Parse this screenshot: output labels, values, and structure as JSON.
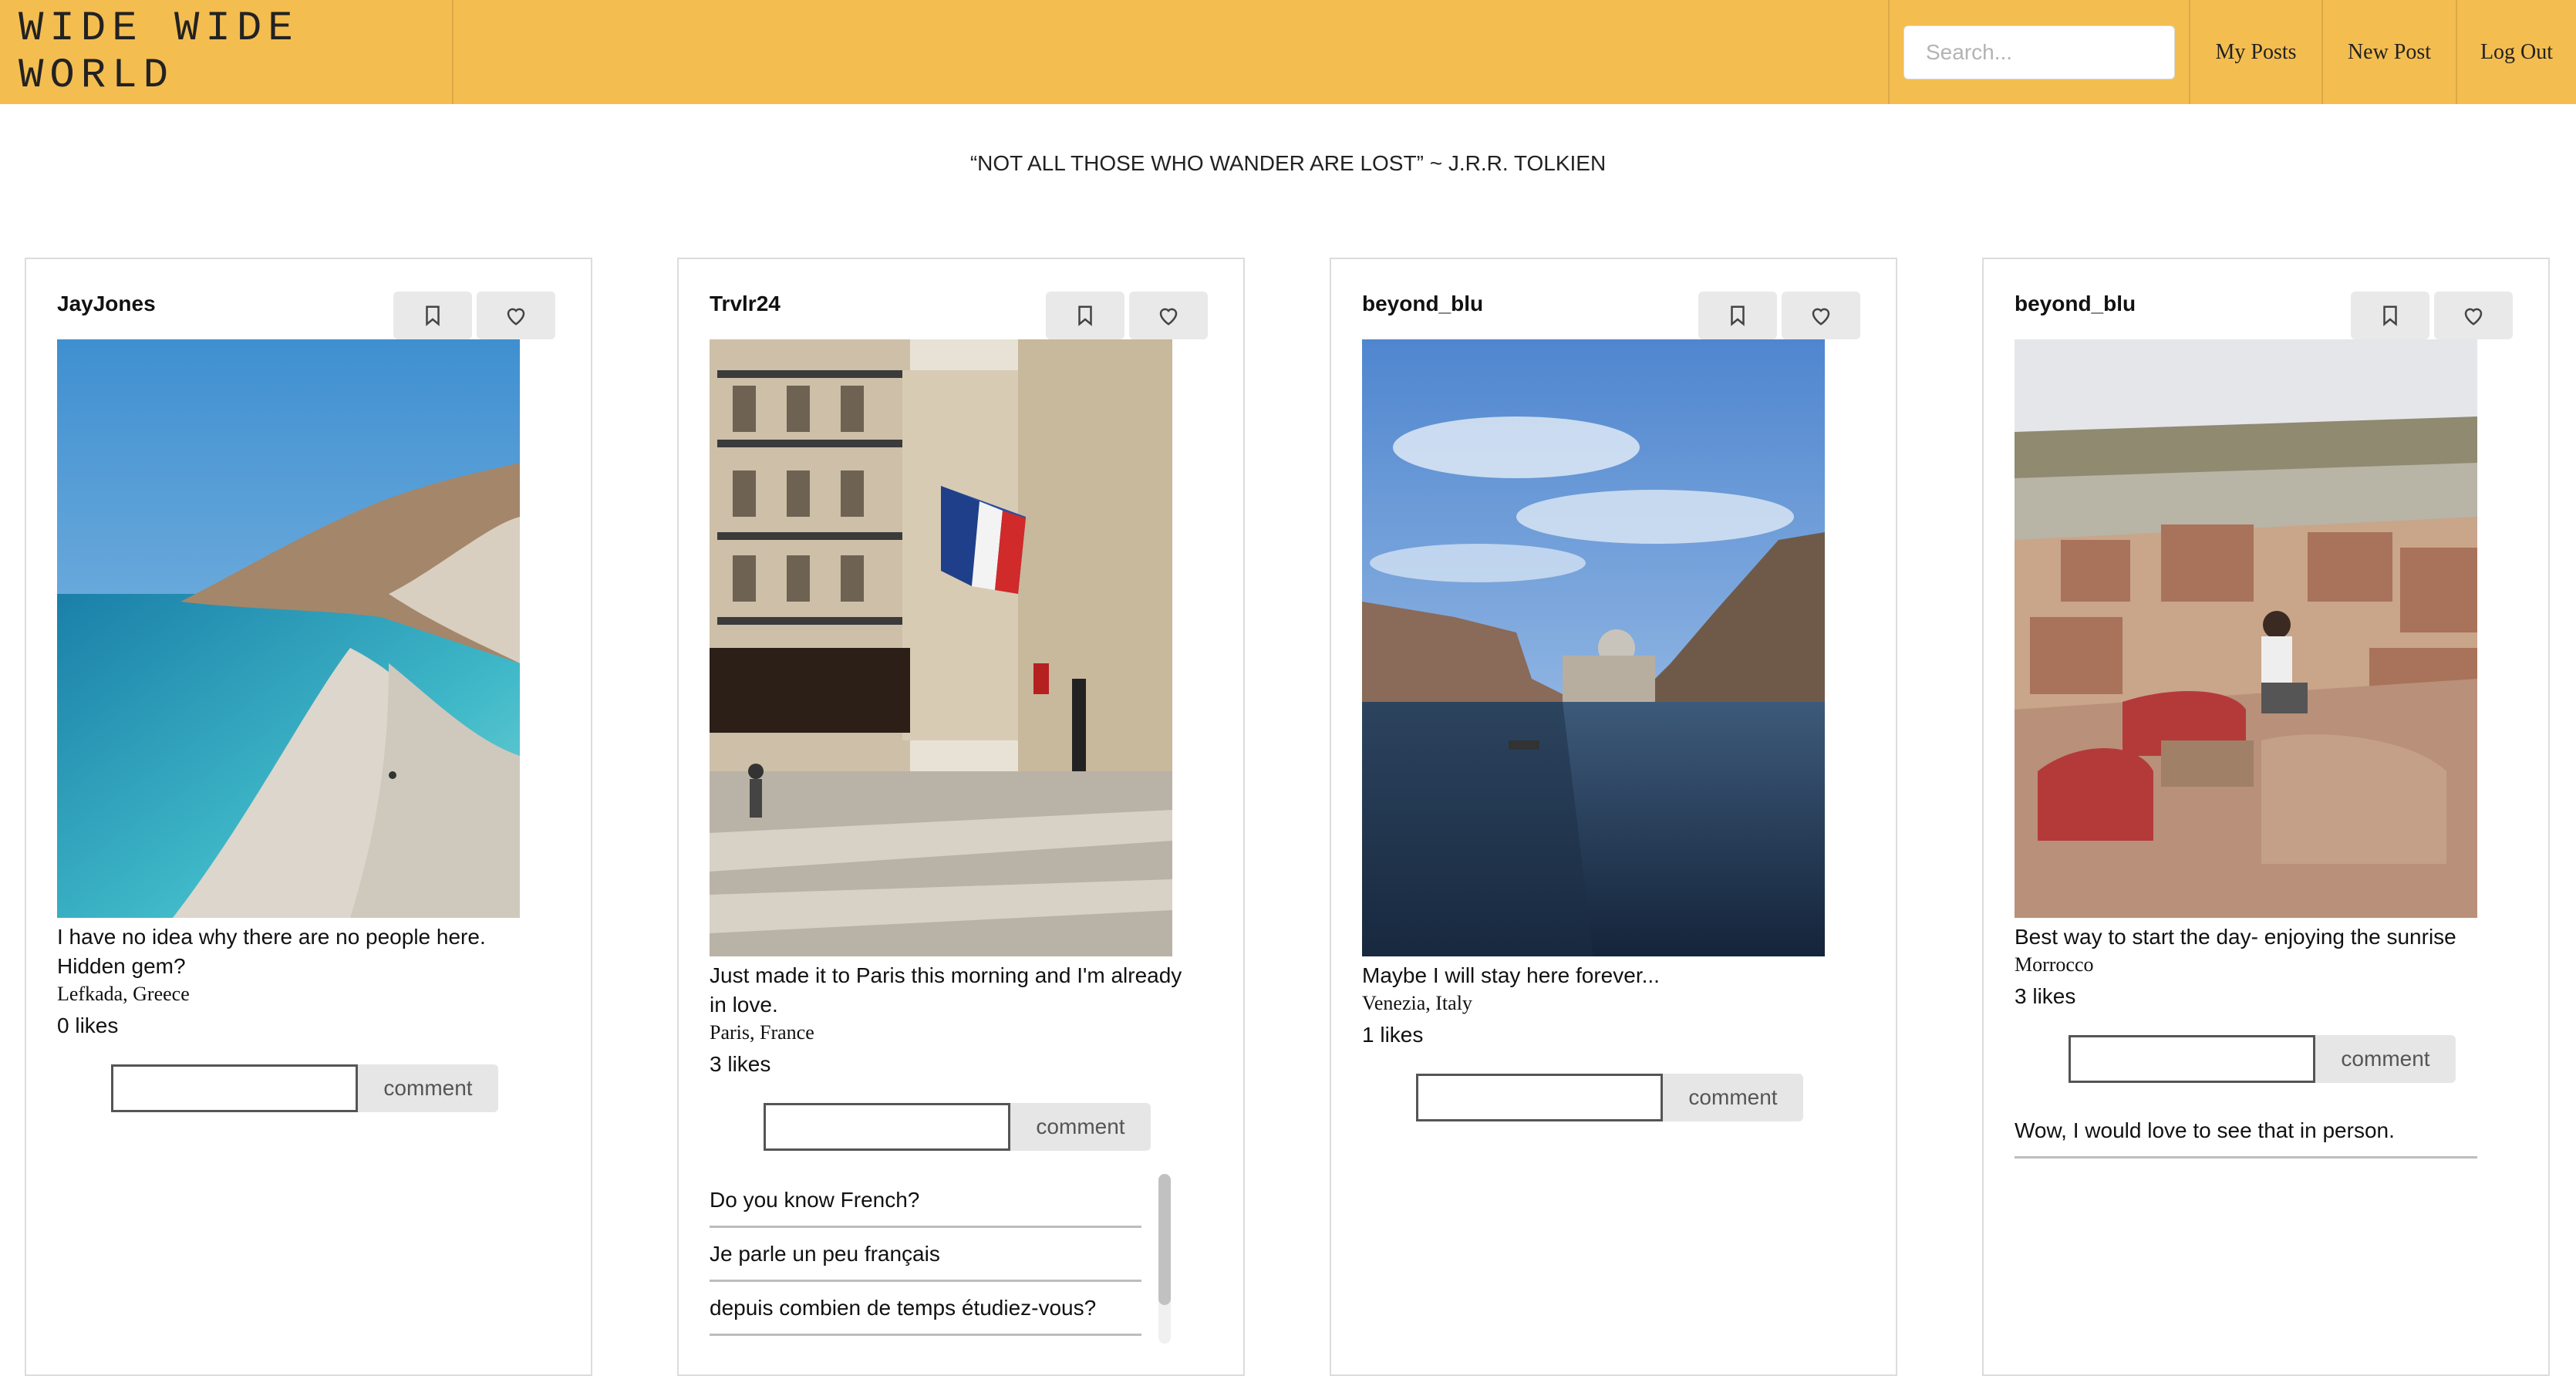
{
  "header": {
    "brand": "WIDE WIDE WORLD",
    "search": {
      "placeholder": "Search...",
      "value": ""
    },
    "nav": [
      "My Posts",
      "New Post",
      "Log Out"
    ],
    "bg_color": "#F4BD50"
  },
  "quote": "“NOT ALL THOSE WHO WANDER ARE LOST” ~ J.R.R. TOLKIEN",
  "posts": [
    {
      "username": "JayJones",
      "caption": "I have no idea why there are no people here. Hidden gem?",
      "location": "Lefkada, Greece",
      "likes": "0 likes",
      "comment_button": "comment",
      "comments": []
    },
    {
      "username": "Trvlr24",
      "caption": "Just made it to Paris this morning and I'm already in love.",
      "location": "Paris, France",
      "likes": "3 likes",
      "comment_button": "comment",
      "comments": [
        "Do you know French?",
        "Je parle un peu français",
        "depuis combien de temps étudiez-vous?"
      ]
    },
    {
      "username": "beyond_blu",
      "caption": "Maybe I will stay here forever...",
      "location": "Venezia, Italy",
      "likes": "1 likes",
      "comment_button": "comment",
      "comments": []
    },
    {
      "username": "beyond_blu",
      "caption": "Best way to start the day- enjoying the sunrise",
      "location": "Morrocco",
      "likes": "3 likes",
      "comment_button": "comment",
      "comments": [
        "Wow, I would love to see that in person."
      ]
    }
  ],
  "icons": {
    "save": "bookmark-icon",
    "like": "heart-icon"
  }
}
